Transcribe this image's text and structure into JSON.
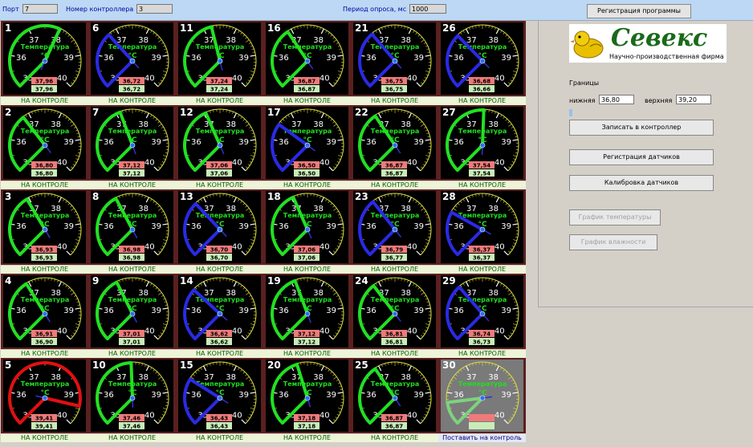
{
  "header": {
    "port_label": "Порт",
    "port_value": "7",
    "controller_label": "Номер контроллера",
    "controller_value": "3",
    "period_label": "Период опроса, мс",
    "period_value": "1000",
    "register_program_label": "Регистрация программы"
  },
  "gauge_labels": {
    "tick_37": "37",
    "tick_38": "38",
    "tick_36": "36",
    "tick_39": "39",
    "tick_35": "35",
    "tick_40": "40",
    "title": "Температура",
    "unit": "°C"
  },
  "sensors": [
    {
      "id": "1",
      "value": 37.96,
      "display": "37,96",
      "reading": "37,96",
      "status": "НА КОНТРОЛЕ",
      "state": "normal",
      "fill": "dark"
    },
    {
      "id": "2",
      "value": 36.8,
      "display": "36,80",
      "reading": "36,80",
      "status": "НА КОНТРОЛЕ",
      "state": "normal",
      "fill": "dark"
    },
    {
      "id": "3",
      "value": 36.93,
      "display": "36,93",
      "reading": "36,93",
      "status": "НА КОНТРОЛЕ",
      "state": "normal",
      "fill": "dark"
    },
    {
      "id": "4",
      "value": 36.91,
      "display": "36,91",
      "reading": "36,90",
      "status": "НА КОНТРОЛЕ",
      "state": "normal",
      "fill": "dark"
    },
    {
      "id": "5",
      "value": 39.41,
      "display": "39,41",
      "reading": "39,41",
      "status": "НА КОНТРОЛЕ",
      "state": "alarm",
      "fill": "dark"
    },
    {
      "id": "6",
      "value": 36.72,
      "display": "36,72",
      "reading": "36,72",
      "status": "НА КОНТРОЛЕ",
      "state": "low",
      "fill": "dark"
    },
    {
      "id": "7",
      "value": 37.12,
      "display": "37,12",
      "reading": "37,12",
      "status": "НА КОНТРОЛЕ",
      "state": "normal",
      "fill": "dark"
    },
    {
      "id": "8",
      "value": 36.98,
      "display": "36,98",
      "reading": "36,98",
      "status": "НА КОНТРОЛЕ",
      "state": "normal",
      "fill": "dark"
    },
    {
      "id": "9",
      "value": 37.01,
      "display": "37,01",
      "reading": "37,01",
      "status": "НА КОНТРОЛЕ",
      "state": "normal",
      "fill": "dark"
    },
    {
      "id": "10",
      "value": 37.46,
      "display": "37,46",
      "reading": "37,46",
      "status": "НА КОНТРОЛЕ",
      "state": "normal",
      "fill": "dark"
    },
    {
      "id": "11",
      "value": 37.24,
      "display": "37,24",
      "reading": "37,24",
      "status": "НА КОНТРОЛЕ",
      "state": "normal",
      "fill": "dark"
    },
    {
      "id": "12",
      "value": 37.06,
      "display": "37,06",
      "reading": "37,06",
      "status": "НА КОНТРОЛЕ",
      "state": "normal",
      "fill": "dark"
    },
    {
      "id": "13",
      "value": 36.7,
      "display": "36,70",
      "reading": "36,70",
      "status": "НА КОНТРОЛЕ",
      "state": "low",
      "fill": "dark"
    },
    {
      "id": "14",
      "value": 36.62,
      "display": "36,62",
      "reading": "36,62",
      "status": "НА КОНТРОЛЕ",
      "state": "low",
      "fill": "dark"
    },
    {
      "id": "15",
      "value": 36.43,
      "display": "36,43",
      "reading": "36,43",
      "status": "НА КОНТРОЛЕ",
      "state": "low",
      "fill": "dark"
    },
    {
      "id": "16",
      "value": 36.87,
      "display": "36,87",
      "reading": "36,87",
      "status": "НА КОНТРОЛЕ",
      "state": "normal",
      "fill": "dark"
    },
    {
      "id": "17",
      "value": 36.5,
      "display": "36,50",
      "reading": "36,50",
      "status": "НА КОНТРОЛЕ",
      "state": "low",
      "fill": "dark"
    },
    {
      "id": "18",
      "value": 37.06,
      "display": "37,06",
      "reading": "37,06",
      "status": "НА КОНТРОЛЕ",
      "state": "normal",
      "fill": "dark"
    },
    {
      "id": "19",
      "value": 37.12,
      "display": "37,12",
      "reading": "37,12",
      "status": "НА КОНТРОЛЕ",
      "state": "normal",
      "fill": "dark"
    },
    {
      "id": "20",
      "value": 37.18,
      "display": "37,18",
      "reading": "37,18",
      "status": "НА КОНТРОЛЕ",
      "state": "normal",
      "fill": "dark"
    },
    {
      "id": "21",
      "value": 36.75,
      "display": "36,75",
      "reading": "36,75",
      "status": "НА КОНТРОЛЕ",
      "state": "low",
      "fill": "dark"
    },
    {
      "id": "22",
      "value": 36.87,
      "display": "36,87",
      "reading": "36,87",
      "status": "НА КОНТРОЛЕ",
      "state": "normal",
      "fill": "dark"
    },
    {
      "id": "23",
      "value": 36.79,
      "display": "36,79",
      "reading": "36,77",
      "status": "НА КОНТРОЛЕ",
      "state": "low",
      "fill": "dark"
    },
    {
      "id": "24",
      "value": 36.81,
      "display": "36,81",
      "reading": "36,81",
      "status": "НА КОНТРОЛЕ",
      "state": "normal",
      "fill": "dark"
    },
    {
      "id": "25",
      "value": 36.87,
      "display": "36,87",
      "reading": "36,87",
      "status": "НА КОНТРОЛЕ",
      "state": "normal",
      "fill": "dark"
    },
    {
      "id": "26",
      "value": 36.68,
      "display": "36,68",
      "reading": "36,66",
      "status": "НА КОНТРОЛЕ",
      "state": "low",
      "fill": "dark"
    },
    {
      "id": "27",
      "value": 37.54,
      "display": "37,54",
      "reading": "37,54",
      "status": "НА КОНТРОЛЕ",
      "state": "normal",
      "fill": "dark"
    },
    {
      "id": "28",
      "value": 36.37,
      "display": "36,37",
      "reading": "36,37",
      "status": "НА КОНТРОЛЕ",
      "state": "low",
      "fill": "dark"
    },
    {
      "id": "29",
      "value": 36.74,
      "display": "36,74",
      "reading": "36,73",
      "status": "НА КОНТРОЛЕ",
      "state": "low",
      "fill": "dark"
    },
    {
      "id": "30",
      "value": null,
      "display": "",
      "reading": "",
      "status": "Поставить на контроль",
      "state": "inactive",
      "fill": "gray"
    }
  ],
  "logo": {
    "title": "Севекс",
    "subtitle": "Научно-производственная фирма"
  },
  "limits": {
    "heading": "Границы",
    "lower_label": "нижняя",
    "lower_value": "36,80",
    "upper_label": "верхняя",
    "upper_value": "39,20",
    "write_label": "Записать в контроллер"
  },
  "actions": {
    "register_sensors": "Регистрация датчиков",
    "calibrate_sensors": "Калибровка датчиков",
    "temp_chart": "График температуры",
    "humidity_chart": "График влажности"
  },
  "colors": {
    "normal": "#22e022",
    "low": "#2a2ae6",
    "alarm": "#e21010",
    "inactive": "#7ed27e",
    "bg_dark": "#000000",
    "bg_gray": "#7a7a7a",
    "dial_ticks": "#dddd44",
    "title_text": "#22dd22"
  }
}
